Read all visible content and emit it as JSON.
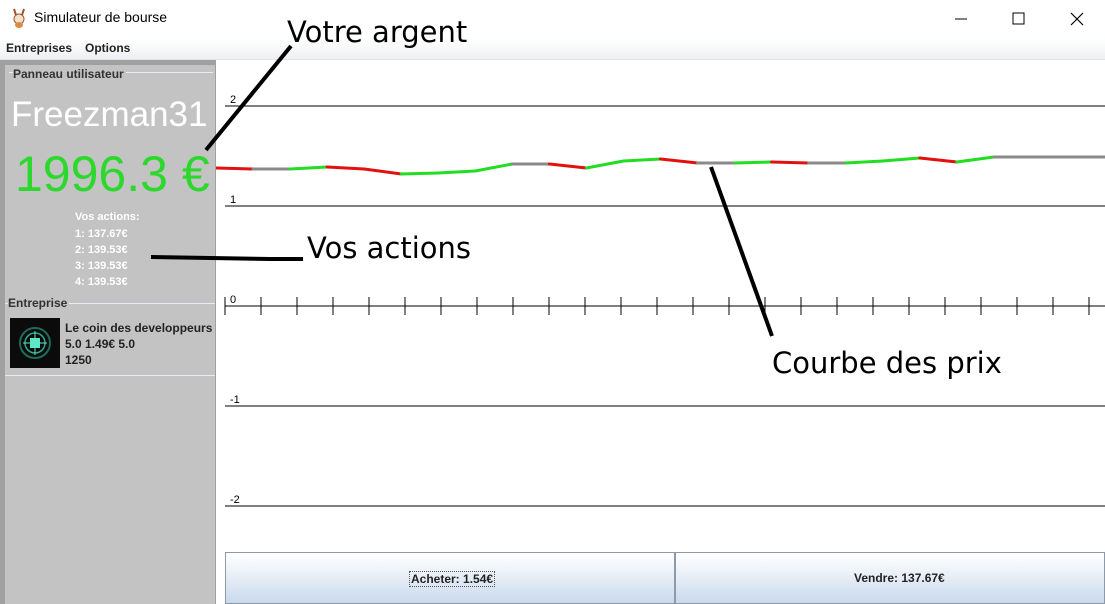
{
  "window": {
    "title": "Simulateur de bourse",
    "controls": [
      "minimize",
      "maximize",
      "close"
    ]
  },
  "menu": {
    "items": [
      {
        "label": "Entreprises"
      },
      {
        "label": "Options"
      }
    ]
  },
  "user_panel": {
    "title": "Panneau utilisateur",
    "username": "Freezman31",
    "money": "1996.3 €",
    "money_color": "#2bd82b",
    "actions_title": "Vos actions:",
    "actions": [
      "1: 137.67€",
      "2: 139.53€",
      "3: 139.53€",
      "4: 139.53€"
    ]
  },
  "company_panel": {
    "title": "Entreprise",
    "name": "Le coin des developpeurs",
    "stats": "5.0 1.49€ 5.0",
    "count": "1250",
    "logo_icon": "circuit-chip-icon"
  },
  "chart_data": {
    "type": "line",
    "ylim": [
      -2.5,
      2.5
    ],
    "yticks": [
      "2",
      "1",
      "0",
      "-1",
      "-2"
    ],
    "grid": true,
    "line_colors": {
      "up": "#22dd22",
      "down": "#e31010",
      "flat": "#8a8a8a"
    },
    "x": [
      0,
      1,
      2,
      3,
      4,
      5,
      6,
      7,
      8,
      9,
      10,
      11,
      12,
      13,
      14,
      15,
      16,
      17,
      18,
      19,
      20,
      21,
      22,
      23,
      24
    ],
    "values": [
      1.38,
      1.37,
      1.37,
      1.39,
      1.37,
      1.32,
      1.33,
      1.35,
      1.42,
      1.42,
      1.38,
      1.45,
      1.47,
      1.43,
      1.43,
      1.44,
      1.43,
      1.43,
      1.45,
      1.48,
      1.44,
      1.49,
      1.49,
      1.49,
      1.49
    ]
  },
  "buttons": {
    "buy": "Acheter: 1.54€",
    "sell": "Vendre: 137.67€"
  },
  "annotations": {
    "money": "Votre argent",
    "actions": "Vos actions",
    "curve": "Courbe des prix"
  }
}
